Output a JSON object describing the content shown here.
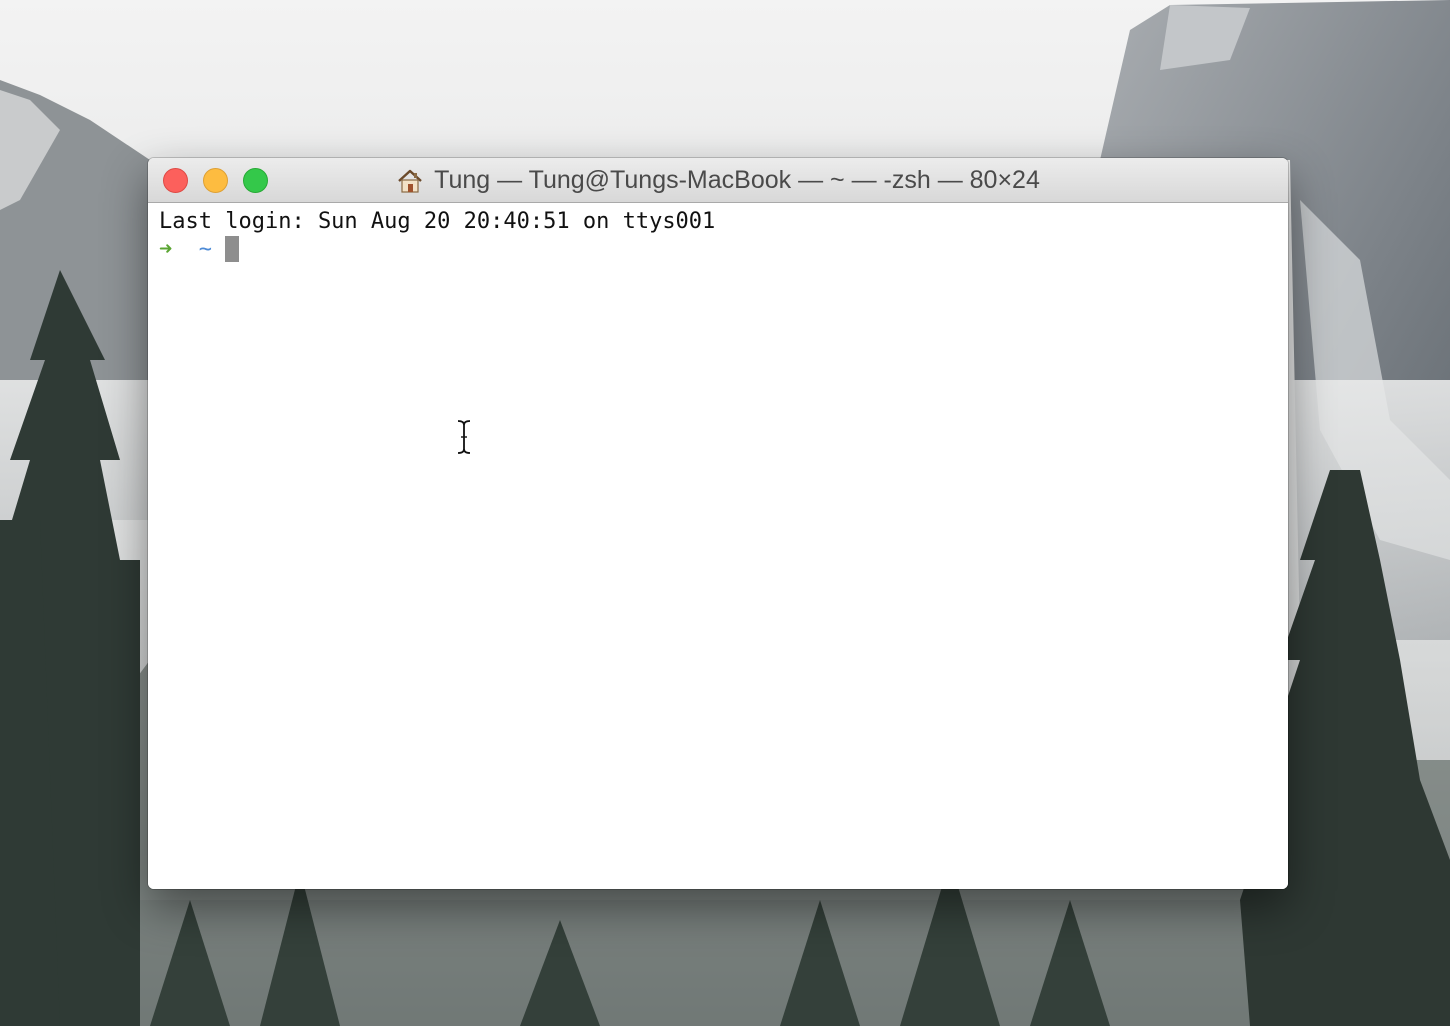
{
  "window": {
    "title": "Tung — Tung@Tungs-MacBook — ~ — -zsh — 80×24",
    "title_icon": "home-icon",
    "buttons": [
      "close",
      "minimize",
      "zoom"
    ]
  },
  "terminal": {
    "last_login": "Last login: Sun Aug 20 20:40:51 on ttys001",
    "prompt_arrow": "➜",
    "prompt_dir": "~"
  },
  "colors": {
    "close": "#fc605c",
    "minimize": "#fdbc40",
    "zoom": "#34c84a",
    "prompt_arrow": "#5aa532",
    "prompt_dir": "#4c8ad6",
    "cursor": "#8e8e8e"
  }
}
